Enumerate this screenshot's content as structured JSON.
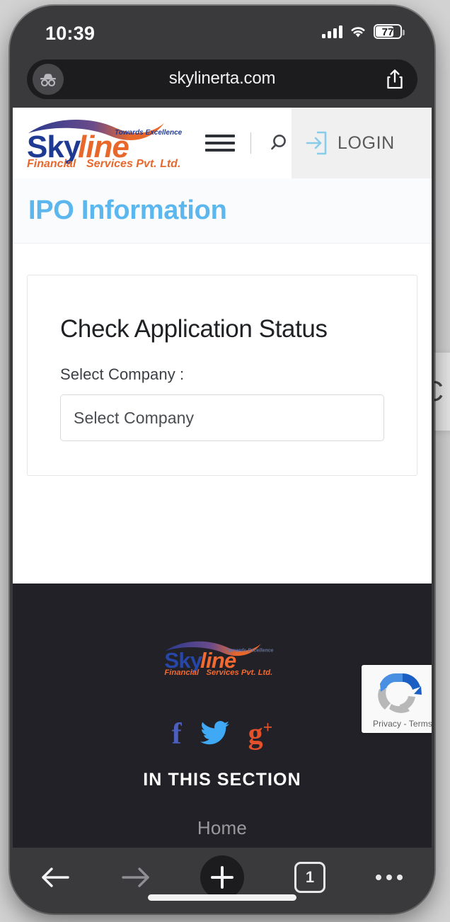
{
  "device": {
    "status_bar": {
      "time": "10:39",
      "battery_level": "77",
      "battery_percent": 77,
      "cellular_icon": "cellular-signal-icon",
      "wifi_icon": "wifi-icon",
      "battery_icon": "battery-icon"
    },
    "home_indicator": "home-indicator"
  },
  "browser": {
    "private_mode_icon": "incognito-mask-icon",
    "url": "skylinerta.com",
    "share_icon": "share-icon",
    "toolbar": {
      "back_label": "Back",
      "back_icon": "arrow-left-icon",
      "forward_label": "Forward",
      "forward_icon": "arrow-right-icon",
      "new_tab_label": "New Tab",
      "new_tab_icon": "plus-icon",
      "tab_count": "1",
      "menu_label": "Menu",
      "menu_icon": "ellipsis-icon"
    }
  },
  "site": {
    "logo": {
      "word_one": "Sky",
      "word_two": "line",
      "tagline": "Towards Excellence",
      "subtitle_one": "Financial",
      "subtitle_two": "Services Pvt. Ltd.",
      "color_blue": "#1f3a93",
      "color_orange": "#e8682c"
    },
    "header": {
      "menu_icon": "hamburger-menu-icon",
      "search_icon": "search-icon",
      "login_icon": "login-arrow-icon",
      "login_label": "LOGIN",
      "login_bg": "#f0f0f0"
    },
    "page_title": "IPO Information",
    "page_title_color": "#5bb7ed",
    "card": {
      "heading": "Check Application Status",
      "select_label": "Select Company :",
      "select_value": "Select Company",
      "select_placeholder": "Select Company"
    },
    "footer": {
      "social": [
        {
          "name": "facebook-icon",
          "glyph": "f",
          "color": "#4d5fbe"
        },
        {
          "name": "twitter-icon",
          "glyph": "",
          "color": "#3fa9f5"
        },
        {
          "name": "google-plus-icon",
          "glyph": "g",
          "sup": "+",
          "color": "#e3502a"
        }
      ],
      "section_heading": "IN THIS SECTION",
      "links": [
        {
          "label": "Home"
        }
      ],
      "background": "#212127"
    },
    "recaptcha": {
      "icon": "recaptcha-logo-icon",
      "text": "Privacy - Terms"
    }
  },
  "background_page": {
    "partial_letter": "C"
  }
}
